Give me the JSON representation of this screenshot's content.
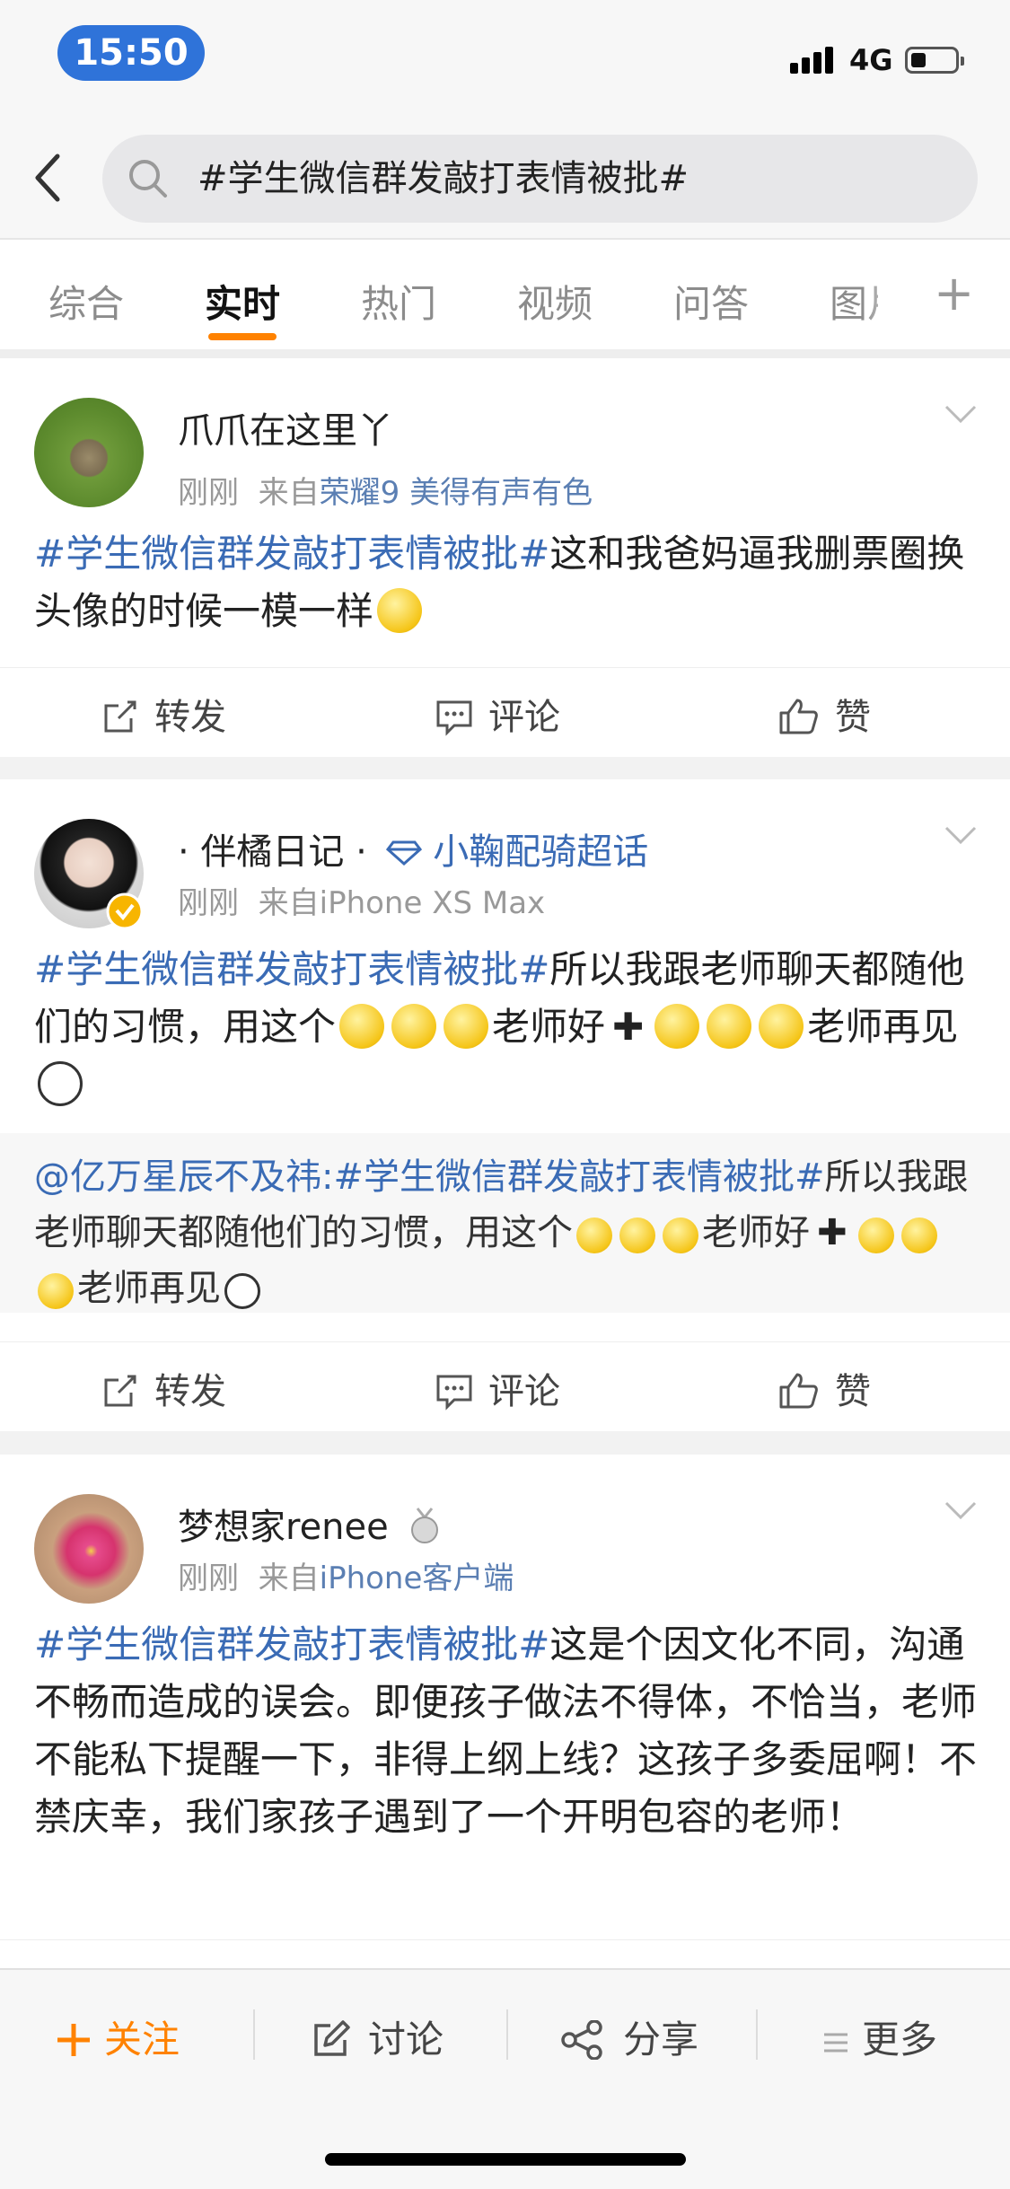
{
  "status": {
    "time": "15:50",
    "network": "4G"
  },
  "search": {
    "query": "#学生微信群发敲打表情被批#"
  },
  "tabs": [
    {
      "label": "综合"
    },
    {
      "label": "实时"
    },
    {
      "label": "热门"
    },
    {
      "label": "视频"
    },
    {
      "label": "问答"
    },
    {
      "label": "图片"
    }
  ],
  "active_tab": "实时",
  "posts": [
    {
      "user": "爪爪在这里丫",
      "time": "刚刚",
      "from_prefix": "来自",
      "source": "荣耀9 美得有声有色",
      "hashtag": "#学生微信群发敲打表情被批#",
      "text_a": "这和我爸妈逼我删票圈换头像的时候一模一样",
      "actions": {
        "repost": "转发",
        "comment": "评论",
        "like": "赞"
      }
    },
    {
      "user": "· 伴橘日记 ·",
      "super_topic": "小鞠配骑超话",
      "time": "刚刚",
      "from_prefix": "来自",
      "source": "iPhone XS Max",
      "hashtag": "#学生微信群发敲打表情被批#",
      "text_a": "所以我跟老师聊天都随他们的习惯，用这个",
      "text_b": "老师好",
      "text_c": "老师再见",
      "repost_user": "@亿万星辰不及祎:",
      "repost_hashtag": "#学生微信群发敲打表情被批#",
      "repost_text_a": "所以我跟老师聊天都随他们的习惯，用这个",
      "repost_text_b": "老师好",
      "repost_text_c": "老师再见",
      "actions": {
        "repost": "转发",
        "comment": "评论",
        "like": "赞"
      }
    },
    {
      "user": "梦想家renee",
      "time": "刚刚",
      "from_prefix": "来自",
      "source": "iPhone客户端",
      "hashtag": "#学生微信群发敲打表情被批#",
      "text_a": "这是个因文化不同，沟通不畅而造成的误会。即便孩子做法不得体，不恰当，老师不能私下提醒一下，非得上纲上线？这孩子多委屈啊！不禁庆幸，我们家孩子遇到了一个开明包容的老师！",
      "actions": {
        "repost": "转发",
        "comment": "评论",
        "like": "赞"
      }
    }
  ],
  "bottom": {
    "follow": "关注",
    "discuss": "讨论",
    "share": "分享",
    "more": "更多"
  },
  "colors": {
    "accent": "#ff8200",
    "link": "#3a6bb5",
    "status_pill": "#2f73d9"
  }
}
